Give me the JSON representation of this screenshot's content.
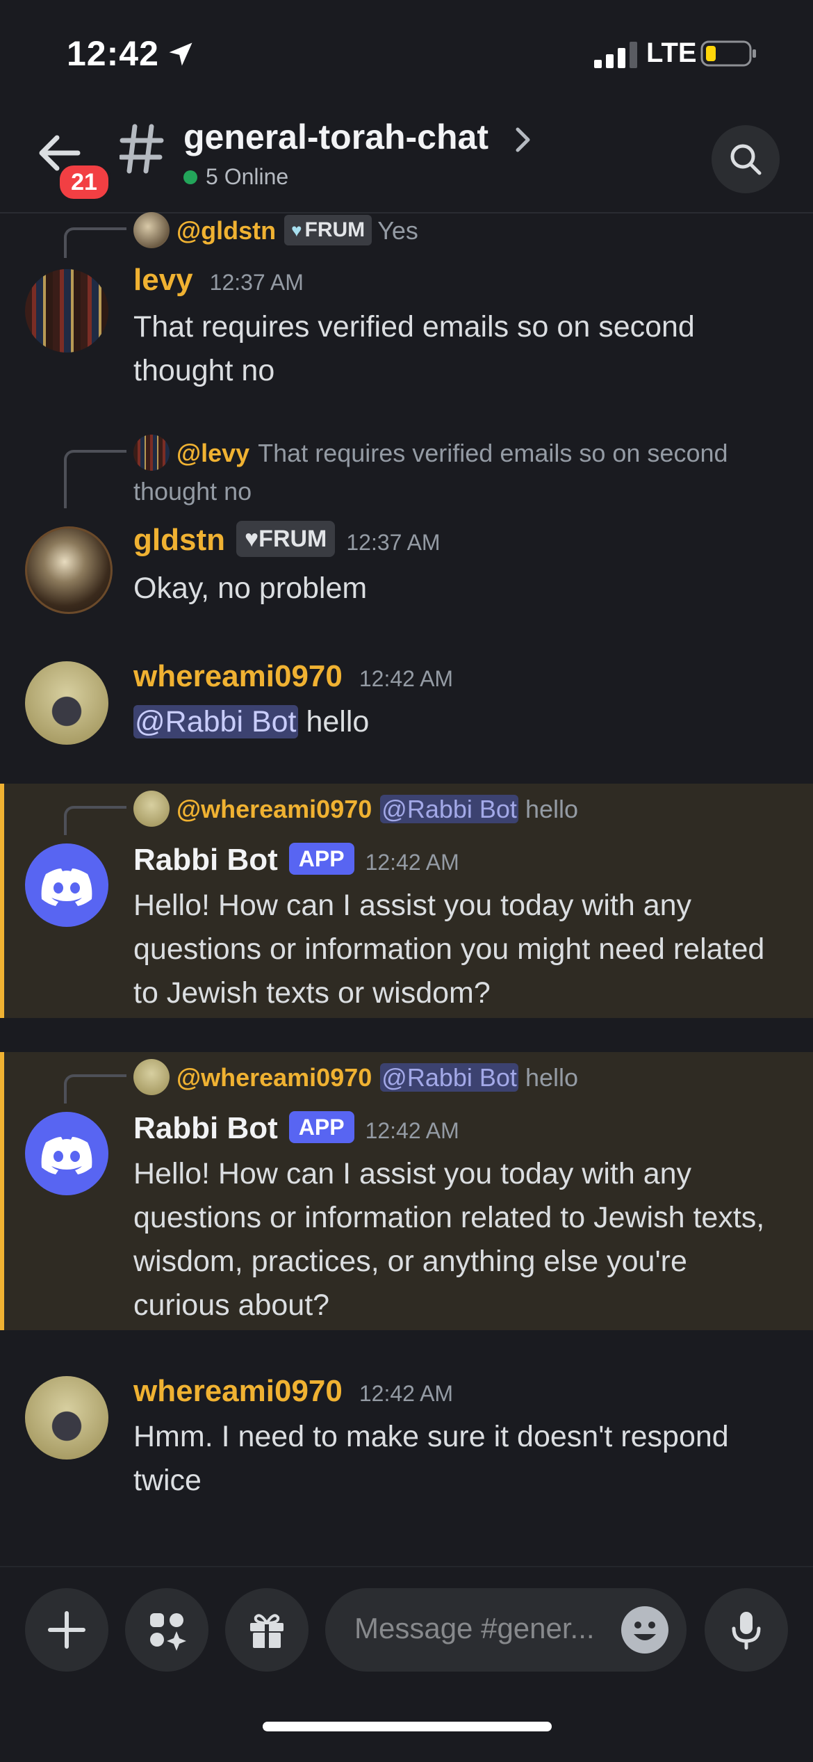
{
  "status_bar": {
    "time": "12:42",
    "network": "LTE"
  },
  "header": {
    "channel_name": "general-torah-chat",
    "online_text": "5 Online",
    "unread_badge": "21"
  },
  "messages": [
    {
      "reply": {
        "name": "@gldstn",
        "tag": "FRUM",
        "text": "Yes"
      },
      "author": "levy",
      "time": "12:37 AM",
      "text": "That requires verified emails so on second thought no"
    },
    {
      "reply": {
        "name": "@levy",
        "text": "That requires verified emails so on second thought no"
      },
      "author": "gldstn",
      "tag": "FRUM",
      "time": "12:37 AM",
      "text": "Okay, no problem"
    },
    {
      "author": "whereami0970",
      "time": "12:42 AM",
      "mention": "@Rabbi Bot",
      "text": " hello"
    },
    {
      "reply": {
        "name": "@whereami0970",
        "mention": "@Rabbi Bot",
        "text": " hello"
      },
      "author": "Rabbi Bot",
      "tag": "APP",
      "time": "12:42 AM",
      "text": "Hello! How can I assist you today with any questions or information you might need related to Jewish texts or wisdom?"
    },
    {
      "reply": {
        "name": "@whereami0970",
        "mention": "@Rabbi Bot",
        "text": " hello"
      },
      "author": "Rabbi Bot",
      "tag": "APP",
      "time": "12:42 AM",
      "text": "Hello! How can I assist you today with any questions or information related to Jewish texts, wisdom, practices, or anything else you're curious about?"
    },
    {
      "author": "whereami0970",
      "time": "12:42 AM",
      "text": "Hmm. I need to make sure it doesn't respond twice"
    }
  ],
  "composer": {
    "placeholder": "Message #gener..."
  },
  "colors": {
    "accent_yellow": "#f0b232",
    "blurple": "#5865f2",
    "online_green": "#23a55a",
    "badge_red": "#f23f43"
  }
}
